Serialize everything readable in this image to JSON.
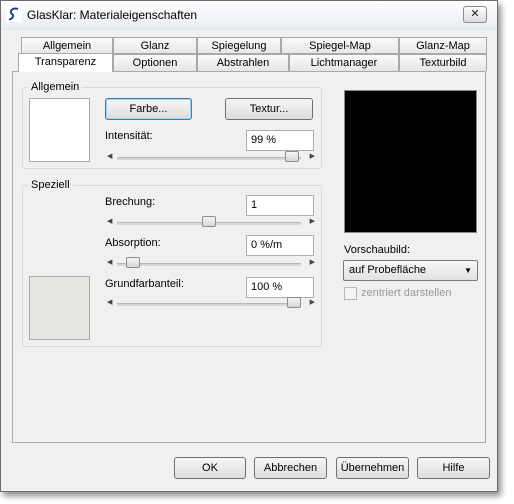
{
  "window": {
    "title": "GlasKlar: Materialeigenschaften",
    "close_glyph": "✕"
  },
  "tabs_row1": [
    "Allgemein",
    "Glanz",
    "Spiegelung",
    "Spiegel-Map",
    "Glanz-Map"
  ],
  "tabs_row2": [
    "Transparenz",
    "Optionen",
    "Abstrahlen",
    "Lichtmanager",
    "Texturbild"
  ],
  "active_tab": "Transparenz",
  "allgemein": {
    "group_title": "Allgemein",
    "color_button": "Farbe...",
    "texture_button": "Textur...",
    "intensity_label": "Intensität:",
    "intensity_value": "99 %",
    "intensity_level_percent": 99
  },
  "speziell": {
    "group_title": "Speziell",
    "refraction_label": "Brechung:",
    "refraction_value": "1",
    "refraction_level_percent": 50,
    "absorption_label": "Absorption:",
    "absorption_value": "0 %/m",
    "absorption_level_percent": 5,
    "base_color_label": "Grundfarbanteil:",
    "base_color_value": "100 %",
    "base_color_level_percent": 100
  },
  "preview": {
    "label": "Vorschaubild:",
    "mode_selected": "auf Probefläche",
    "center_label": "zentriert darstellen",
    "center_checked": false
  },
  "buttons": {
    "ok": "OK",
    "cancel": "Abbrechen",
    "apply": "Übernehmen",
    "help": "Hilfe"
  },
  "colors": {
    "preview_bg": "#000000",
    "transparency_swatch": "#e7e7e3",
    "color_swatch": "#ffffff"
  },
  "icons": {
    "app": "glasklar-logo-icon",
    "slider_left": "arrow-left-icon",
    "slider_right": "arrow-right-icon",
    "dropdown": "chevron-down-icon"
  }
}
